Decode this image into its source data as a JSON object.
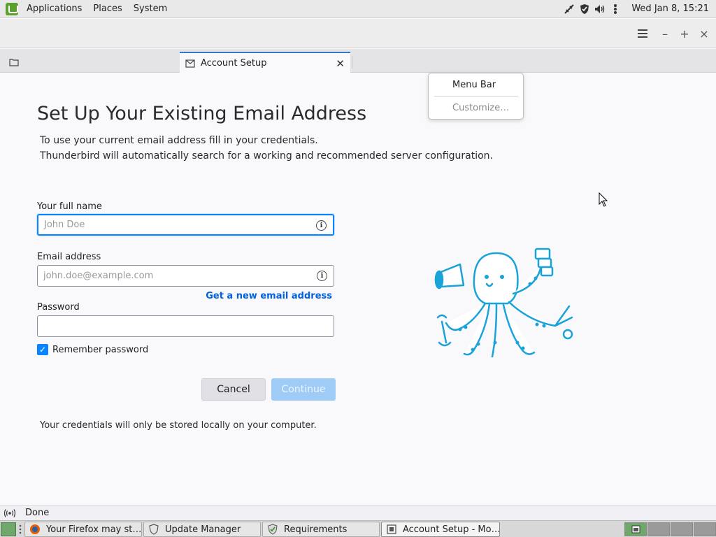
{
  "panel": {
    "menus": [
      "Applications",
      "Places",
      "System"
    ],
    "clock": "Wed Jan  8, 15:21"
  },
  "tab": {
    "label": "Account Setup"
  },
  "menu": {
    "items": [
      "Menu Bar",
      "Customize…"
    ]
  },
  "page": {
    "title": "Set Up Your Existing Email Address",
    "intro_line1": "To use your current email address fill in your credentials.",
    "intro_line2": "Thunderbird will automatically search for a working and recommended server configuration.",
    "name_label": "Your full name",
    "name_placeholder": "John Doe",
    "email_label": "Email address",
    "email_placeholder": "john.doe@example.com",
    "new_email_link": "Get a new email address",
    "password_label": "Password",
    "password_value": "",
    "remember_label": "Remember password",
    "remember_checked": true,
    "cancel_label": "Cancel",
    "continue_label": "Continue",
    "note": "Your credentials will only be stored locally on your computer."
  },
  "status": {
    "text": "Done"
  },
  "taskbar": {
    "tasks": [
      "Your Firefox may st…",
      "Update Manager",
      "Requirements",
      "Account Setup - Mo…"
    ]
  },
  "colors": {
    "accent": "#0a84ff",
    "link": "#0061e0",
    "mascot": "#1aa3d8"
  }
}
